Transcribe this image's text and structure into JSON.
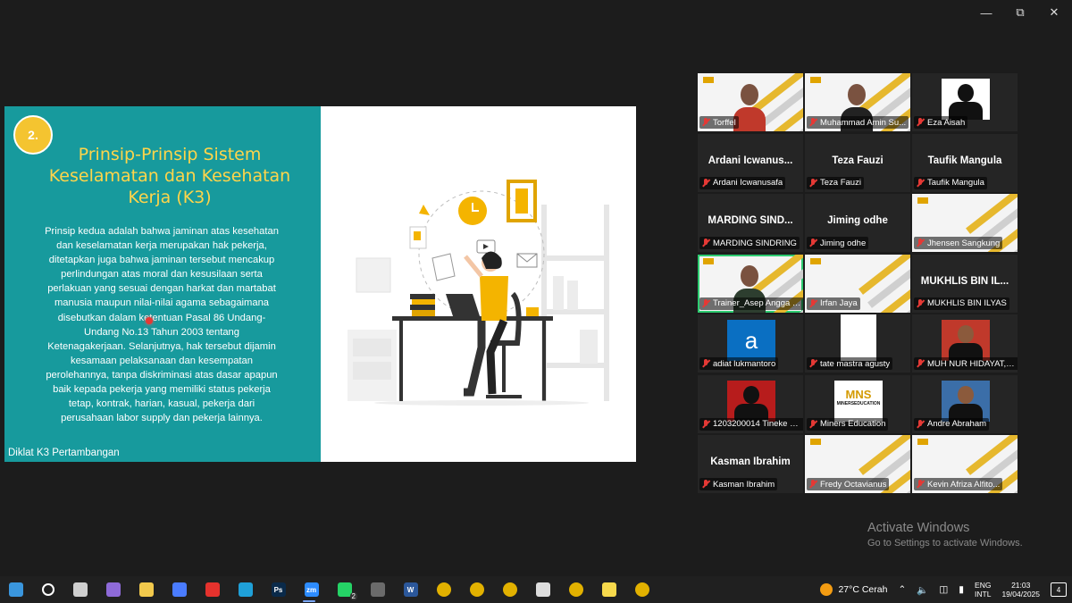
{
  "slide": {
    "badge": "2.",
    "title_lines": [
      "Prinsip-Prinsip Sistem",
      "Keselamatan dan Kesehatan",
      "Kerja (K3)"
    ],
    "body_lines": [
      "Prinsip kedua adalah bahwa jaminan atas kesehatan",
      "dan keselamatan kerja merupakan hak pekerja,",
      "ditetapkan juga bahwa jaminan tersebut mencakup",
      "perlindungan atas moral dan kesusilaan serta",
      "perlakuan yang sesuai dengan harkat dan martabat",
      "manusia maupun nilai-nilai agama sebagaimana",
      "disebutkan dalam ketentuan Pasal 86 Undang-",
      "Undang No.13 Tahun 2003 tentang",
      "Ketenagakerjaan. Selanjutnya, hak tersebut dijamin",
      "kesamaan pelaksanaan dan kesempatan",
      "perolehannya, tanpa diskriminasi atas dasar apapun",
      "baik kepada pekerja yang memiliki status pekerja",
      "tetap, kontrak, harian, kasual, pekerja dari",
      "perusahaan labor supply dan pekerja lainnya."
    ],
    "footer": "Diklat K3 Pertambangan"
  },
  "participants": [
    {
      "label": "Torffel",
      "big": "",
      "kind": "video"
    },
    {
      "label": "Muhammad Amin Su...",
      "big": "",
      "kind": "video"
    },
    {
      "label": "Eza Aisah",
      "big": "",
      "kind": "photo"
    },
    {
      "label": "Ardani Icwanusafa",
      "big": "Ardani Icwanus...",
      "kind": "name"
    },
    {
      "label": "Teza Fauzi",
      "big": "Teza Fauzi",
      "kind": "name"
    },
    {
      "label": "Taufik Mangula",
      "big": "Taufik Mangula",
      "kind": "name"
    },
    {
      "label": "MARDING SINDRING",
      "big": "MARDING SIND...",
      "kind": "name"
    },
    {
      "label": "Jiming odhe",
      "big": "Jiming odhe",
      "kind": "name"
    },
    {
      "label": "Jhensen Sangkung",
      "big": "",
      "kind": "video"
    },
    {
      "label": "Trainer_Asep Angga Kus...",
      "big": "",
      "kind": "video"
    },
    {
      "label": "Irfan Jaya",
      "big": "",
      "kind": "video"
    },
    {
      "label": "MUKHLIS BIN ILYAS",
      "big": "MUKHLIS BIN IL...",
      "kind": "name"
    },
    {
      "label": "adiat lukmantoro",
      "big": "",
      "kind": "letter",
      "letter": "a"
    },
    {
      "label": "tate mastra agusty",
      "big": "",
      "kind": "white"
    },
    {
      "label": "MUH NUR HIDAYAT, S...",
      "big": "",
      "kind": "photo"
    },
    {
      "label": "1203200014 Tineke S...",
      "big": "",
      "kind": "photo"
    },
    {
      "label": "Miners Education",
      "big": "",
      "kind": "logo",
      "logo_text": "MNS",
      "logo_sub": "MINERSEDUCATION"
    },
    {
      "label": "Andre Abraham",
      "big": "",
      "kind": "photo"
    },
    {
      "label": "Kasman Ibrahim",
      "big": "Kasman Ibrahim",
      "kind": "name"
    },
    {
      "label": "Fredy Octavianus",
      "big": "",
      "kind": "video"
    },
    {
      "label": "Kevin Afriza Alfito...",
      "big": "",
      "kind": "video"
    }
  ],
  "activate": {
    "title": "Activate Windows",
    "subtitle": "Go to Settings to activate Windows."
  },
  "taskbar": {
    "apps": [
      "start-icon",
      "search-icon",
      "task-view-icon",
      "copilot-icon",
      "file-explorer-icon",
      "store-icon",
      "pdf-icon",
      "edge-icon",
      "photoshop-icon",
      "zoom-icon",
      "whatsapp-icon",
      "calculator-icon",
      "word-icon",
      "chrome-icon",
      "chrome-icon",
      "chrome-icon",
      "media-icon",
      "chrome-icon",
      "sticky-notes-icon",
      "chrome-icon"
    ],
    "zoom_label": "zm",
    "ps_label": "Ps",
    "word_label": "W",
    "whatsapp_count": "2",
    "weather": "27°C",
    "weather_desc": "Cerah",
    "lang1": "ENG",
    "lang2": "INTL",
    "time": "21:03",
    "date": "19/04/2025",
    "notif_count": "4"
  },
  "colors": {
    "teal": "#179a9d",
    "yellow": "#f4c430",
    "active": "#2ecc71"
  }
}
